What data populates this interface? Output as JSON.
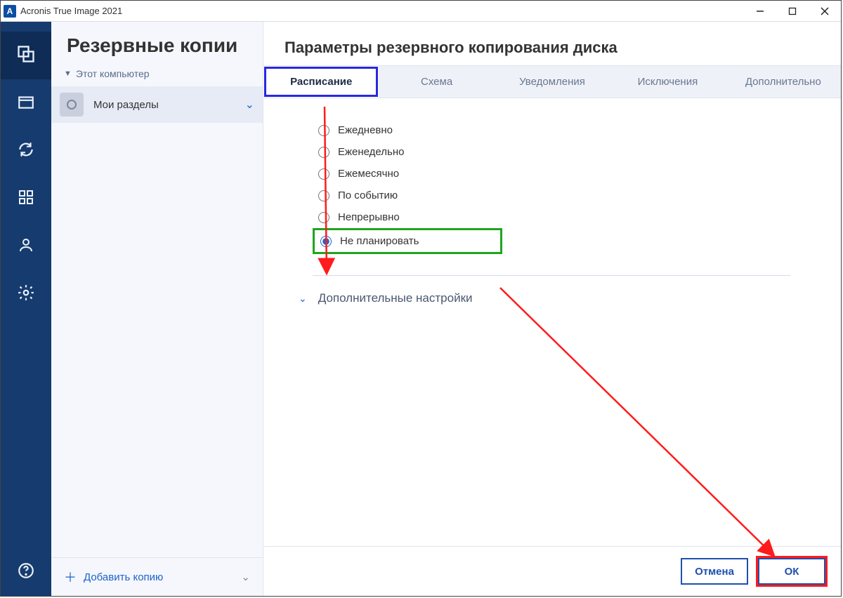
{
  "window": {
    "title": "Acronis True Image 2021",
    "app_icon_letter": "A"
  },
  "side_rail": {
    "items": [
      {
        "name": "backup",
        "icon": "backup"
      },
      {
        "name": "archive",
        "icon": "archive"
      },
      {
        "name": "sync",
        "icon": "sync"
      },
      {
        "name": "dashboard",
        "icon": "dashboard"
      },
      {
        "name": "account",
        "icon": "account"
      },
      {
        "name": "settings",
        "icon": "settings"
      }
    ]
  },
  "left": {
    "title": "Резервные копии",
    "group": "Этот компьютер",
    "item1": "Мои разделы",
    "add_label": "Добавить копию"
  },
  "options": {
    "heading": "Параметры резервного копирования диска",
    "tabs": {
      "schedule": "Расписание",
      "scheme": "Схема",
      "notify": "Уведомления",
      "exclude": "Исключения",
      "advanced": "Дополнительно"
    },
    "radios": {
      "daily": "Ежедневно",
      "weekly": "Еженедельно",
      "monthly": "Ежемесячно",
      "event": "По событию",
      "nonstop": "Непрерывно",
      "none": "Не планировать"
    },
    "selected": "none",
    "expander": "Дополнительные настройки",
    "cancel": "Отмена",
    "ok": "ОК"
  },
  "annotation": {
    "arrow1_color": "#ff1b1b",
    "arrow2_color": "#ff1b1b"
  }
}
